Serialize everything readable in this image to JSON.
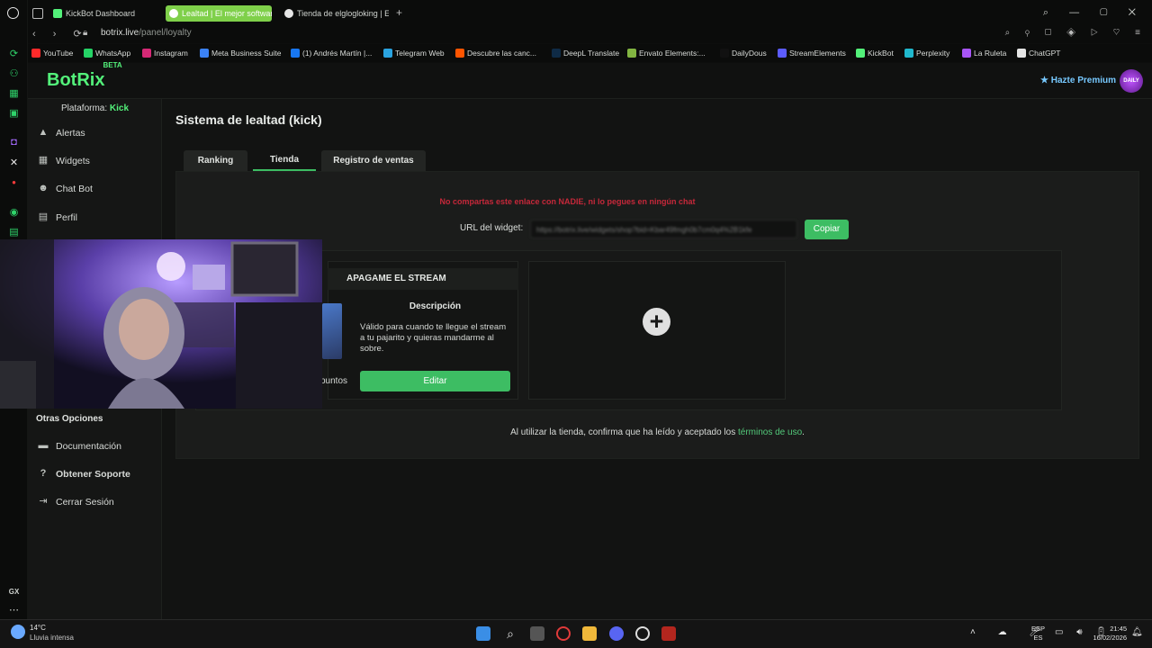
{
  "browser": {
    "tabs": [
      {
        "label": "KickBot Dashboard",
        "active": false,
        "color": "#53f17a"
      },
      {
        "label": "Lealtad | El mejor softwar",
        "active": true,
        "color": "#ffffff"
      },
      {
        "label": "Tienda de elglogloking | El",
        "active": false,
        "color": "#e6e6e6"
      }
    ],
    "new_tab": "+",
    "url_host": "botrix.live",
    "url_path": "/panel/loyalty",
    "bookmarks": [
      {
        "label": "YouTube",
        "color": "#ff2a2a"
      },
      {
        "label": "WhatsApp",
        "color": "#25d366"
      },
      {
        "label": "Instagram",
        "color": "#d62976"
      },
      {
        "label": "Meta Business Suite",
        "color": "#3b82f6"
      },
      {
        "label": "(1) Andrés Martín |...",
        "color": "#1877f2"
      },
      {
        "label": "Telegram Web",
        "color": "#2aa3e0"
      },
      {
        "label": "Descubre las canc...",
        "color": "#ff5500"
      },
      {
        "label": "DeepL Translate",
        "color": "#0f2b46"
      },
      {
        "label": "Envato Elements:...",
        "color": "#82b541"
      },
      {
        "label": "DailyDous",
        "color": "#111111"
      },
      {
        "label": "StreamElements",
        "color": "#5c5cff"
      },
      {
        "label": "KickBot",
        "color": "#53f17a"
      },
      {
        "label": "Perplexity",
        "color": "#20b8cd"
      },
      {
        "label": "La Ruleta",
        "color": "#a855f7"
      },
      {
        "label": "ChatGPT",
        "color": "#e5e5e5"
      }
    ]
  },
  "header": {
    "logo": "BotRix",
    "logo_badge": "BETA",
    "premium_label": "Hazte Premium",
    "avatar_text": "DAILY"
  },
  "sidebar": {
    "platform_label": "Plataforma:",
    "platform_value": "Kick",
    "items": [
      {
        "label": "Alertas",
        "icon": "warning-icon"
      },
      {
        "label": "Widgets",
        "icon": "grid-icon"
      },
      {
        "label": "Chat Bot",
        "icon": "robot-icon"
      },
      {
        "label": "Perfil",
        "icon": "id-card-icon"
      }
    ],
    "other_title": "Otras Opciones",
    "other_items": [
      {
        "label": "Documentación",
        "icon": "book-icon"
      },
      {
        "label": "Obtener Soporte",
        "icon": "help-icon"
      },
      {
        "label": "Cerrar Sesión",
        "icon": "logout-icon"
      }
    ]
  },
  "main": {
    "title": "Sistema de lealtad (kick)",
    "tabs": [
      "Ranking",
      "Tienda",
      "Registro de ventas"
    ],
    "active_tab": "Tienda",
    "warning": "No compartas este enlace con NADIE, ni lo pegues en ningún chat",
    "url_label": "URL del widget:",
    "url_value": "https://botrix.live/widgets/shop?bid=Kbar49fmgh0b7cm0q4%2B1kfe",
    "copy_label": "Copiar",
    "item": {
      "title": "APAGAME EL STREAM",
      "desc_label": "Descripción",
      "desc": "Válido para cuando te llegue el stream a tu pajarito y quieras mandarme al sobre.",
      "points": "puntos",
      "edit_label": "Editar"
    },
    "add_icon": "+",
    "terms_text": "Al utilizar la tienda, confirma que ha leído y aceptado los",
    "terms_link": "términos de uso",
    "terms_end": "."
  },
  "taskbar": {
    "temp": "14°C",
    "weather": "Lluvia intensa",
    "lang_top": "ESP",
    "lang_bottom": "ES",
    "time": "21:45",
    "date": "16/02/2026"
  },
  "colors": {
    "accent": "#3dbd63",
    "logo": "#53f17a",
    "warning": "#c6283a"
  }
}
